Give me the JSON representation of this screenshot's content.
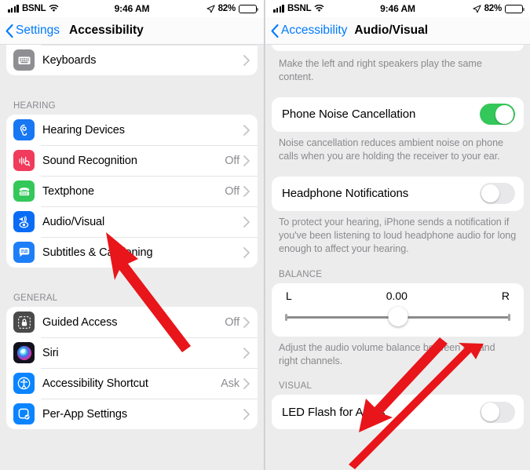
{
  "status_bar": {
    "carrier": "BSNL",
    "time": "9:46 AM",
    "battery_pct": "82%",
    "signal_icon": "cellular-bars-icon",
    "wifi_icon": "wifi-icon",
    "location_icon": "location-arrow-icon",
    "battery_icon": "battery-icon"
  },
  "colors": {
    "accent_blue": "#007aff",
    "toggle_on_green": "#34c759",
    "arrow_red": "#e8151a",
    "page_bg": "#ececed",
    "card_bg": "#ffffff",
    "secondary_text": "#8a8a8e"
  },
  "left_screen": {
    "nav": {
      "back_label": "Settings",
      "title": "Accessibility"
    },
    "groups": [
      {
        "header": "",
        "items": [
          {
            "label": "Keyboards",
            "value": "",
            "icon": "keyboard-icon",
            "icon_color": "#8e8e93",
            "chevron": true
          }
        ]
      },
      {
        "header": "HEARING",
        "items": [
          {
            "label": "Hearing Devices",
            "value": "",
            "icon": "ear-icon",
            "icon_color": "#1877f2",
            "chevron": true
          },
          {
            "label": "Sound Recognition",
            "value": "Off",
            "icon": "sound-waves-search-icon",
            "icon_color": "#f03b5c",
            "chevron": true
          },
          {
            "label": "Textphone",
            "value": "Off",
            "icon": "textphone-icon",
            "icon_color": "#34c759",
            "chevron": true
          },
          {
            "label": "Audio/Visual",
            "value": "",
            "icon": "speaker-eye-icon",
            "icon_color": "#0a6cf5",
            "chevron": true
          },
          {
            "label": "Subtitles & Captioning",
            "value": "",
            "icon": "caption-bubble-icon",
            "icon_color": "#1e7ef7",
            "chevron": true
          }
        ]
      },
      {
        "header": "GENERAL",
        "items": [
          {
            "label": "Guided Access",
            "value": "Off",
            "icon": "lock-dashed-icon",
            "icon_color": "#4a4a4a",
            "chevron": true
          },
          {
            "label": "Siri",
            "value": "",
            "icon": "siri-orb-icon",
            "icon_color": "#1c1c2e",
            "chevron": true
          },
          {
            "label": "Accessibility Shortcut",
            "value": "Ask",
            "icon": "accessibility-person-icon",
            "icon_color": "#0a84ff",
            "chevron": true
          },
          {
            "label": "Per-App Settings",
            "value": "",
            "icon": "per-app-check-icon",
            "icon_color": "#0a84ff",
            "chevron": true
          }
        ]
      }
    ]
  },
  "right_screen": {
    "nav": {
      "back_label": "Accessibility",
      "title": "Audio/Visual"
    },
    "top_footnote": "Make the left and right speakers play the same content.",
    "phone_noise_cancellation": {
      "label": "Phone Noise Cancellation",
      "state": "on",
      "footnote": "Noise cancellation reduces ambient noise on phone calls when you are holding the receiver to your ear."
    },
    "headphone_notifications": {
      "label": "Headphone Notifications",
      "state": "off",
      "footnote": "To protect your hearing, iPhone sends a notification if you've been listening to loud headphone audio for long enough to affect your hearing."
    },
    "balance": {
      "header": "BALANCE",
      "left_label": "L",
      "value": "0.00",
      "right_label": "R",
      "slider_position_pct": 50,
      "footnote": "Adjust the audio volume balance between left and right channels."
    },
    "visual": {
      "header": "VISUAL",
      "led_flash": {
        "label": "LED Flash for Alerts",
        "state": "off"
      }
    }
  },
  "annotations": [
    {
      "name": "arrow-to-audio-visual",
      "target": "Audio/Visual"
    },
    {
      "name": "arrow-to-balance-slider",
      "target": "Balance slider"
    },
    {
      "name": "arrow-to-led-flash",
      "target": "LED Flash for Alerts"
    }
  ]
}
